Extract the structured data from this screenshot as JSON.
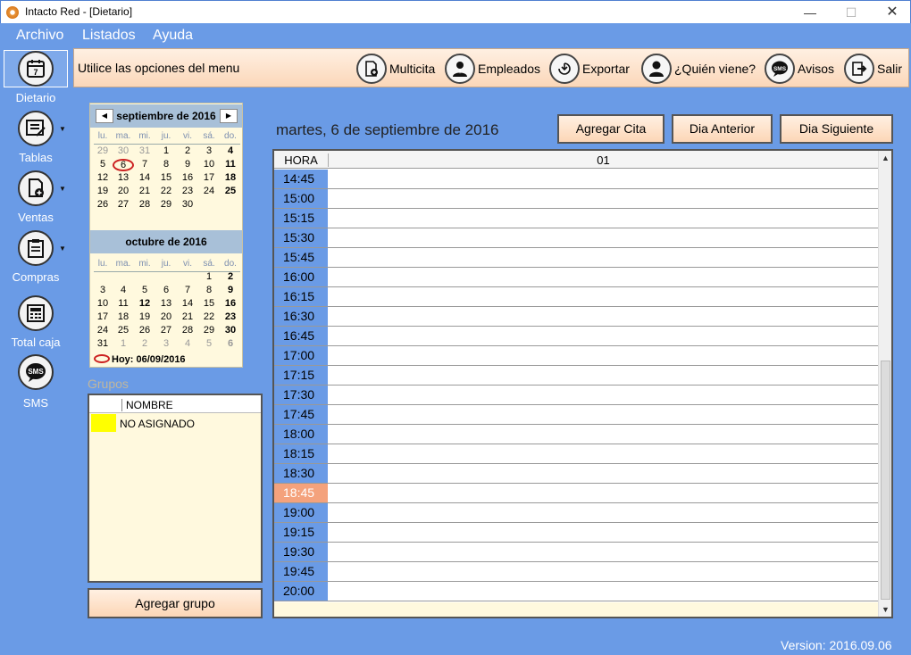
{
  "window": {
    "title": "Intacto Red - [Dietario]",
    "min": "—",
    "max": "☐",
    "close": "✕"
  },
  "menu": [
    "Archivo",
    "Listados",
    "Ayuda"
  ],
  "sidebar": [
    {
      "label": "Dietario",
      "icon": "calendar-icon"
    },
    {
      "label": "Tablas",
      "icon": "table-icon"
    },
    {
      "label": "Ventas",
      "icon": "sales-icon"
    },
    {
      "label": "Compras",
      "icon": "clipboard-icon"
    },
    {
      "label": "Total caja",
      "icon": "calculator-icon"
    },
    {
      "label": "SMS",
      "icon": "sms-icon"
    }
  ],
  "toolbar": {
    "hint": "Utilice las opciones del menu",
    "buttons": [
      {
        "label": "Multicita",
        "icon": "document-add-icon"
      },
      {
        "label": "Empleados",
        "icon": "employees-icon"
      },
      {
        "label": "Exportar",
        "icon": "export-icon"
      },
      {
        "label": "¿Quién viene?",
        "icon": "person-icon"
      },
      {
        "label": "Avisos",
        "icon": "sms-icon"
      },
      {
        "label": "Salir",
        "icon": "exit-icon"
      }
    ]
  },
  "calendar": {
    "dow": [
      "lu.",
      "ma.",
      "mi.",
      "ju.",
      "vi.",
      "sá.",
      "do."
    ],
    "months": [
      {
        "title": "septiembre de 2016",
        "weeks": [
          [
            "29",
            "30",
            "31",
            "1",
            "2",
            "3",
            "4"
          ],
          [
            "5",
            "6",
            "7",
            "8",
            "9",
            "10",
            "11"
          ],
          [
            "12",
            "13",
            "14",
            "15",
            "16",
            "17",
            "18"
          ],
          [
            "19",
            "20",
            "21",
            "22",
            "23",
            "24",
            "25"
          ],
          [
            "26",
            "27",
            "28",
            "29",
            "30",
            "",
            ""
          ]
        ]
      },
      {
        "title": "octubre de 2016",
        "weeks": [
          [
            "",
            "",
            "",
            "",
            "",
            "1",
            "2"
          ],
          [
            "3",
            "4",
            "5",
            "6",
            "7",
            "8",
            "9"
          ],
          [
            "10",
            "11",
            "12",
            "13",
            "14",
            "15",
            "16"
          ],
          [
            "17",
            "18",
            "19",
            "20",
            "21",
            "22",
            "23"
          ],
          [
            "24",
            "25",
            "26",
            "27",
            "28",
            "29",
            "30"
          ],
          [
            "31",
            "1",
            "2",
            "3",
            "4",
            "5",
            "6"
          ]
        ]
      }
    ],
    "today_label": "Hoy: 06/09/2016"
  },
  "groups": {
    "label": "Grupos",
    "column": "NOMBRE",
    "rows": [
      {
        "name": "NO ASIGNADO",
        "color": "#ffff00"
      }
    ],
    "add_button": "Agregar grupo"
  },
  "day": {
    "date": "martes, 6 de septiembre de 2016",
    "add_button": "Agregar Cita",
    "prev_button": "Dia Anterior",
    "next_button": "Dia Siguiente",
    "col_hour": "HORA",
    "col_main": "01",
    "current_slot": "18:45",
    "slots": [
      "14:45",
      "15:00",
      "15:15",
      "15:30",
      "15:45",
      "16:00",
      "16:15",
      "16:30",
      "16:45",
      "17:00",
      "17:15",
      "17:30",
      "17:45",
      "18:00",
      "18:15",
      "18:30",
      "18:45",
      "19:00",
      "19:15",
      "19:30",
      "19:45",
      "20:00"
    ]
  },
  "status": {
    "version": "Version: 2016.09.06"
  },
  "colors": {
    "accent": "#6a9be6",
    "peach": "#fcd6b6",
    "current_hour": "#f4a27c"
  }
}
